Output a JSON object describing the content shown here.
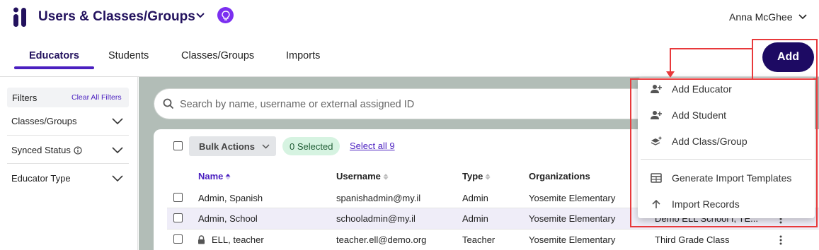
{
  "header": {
    "app_title": "Users & Classes/Groups",
    "user_name": "Anna McGhee"
  },
  "tabs": [
    {
      "label": "Educators",
      "active": true
    },
    {
      "label": "Students",
      "active": false
    },
    {
      "label": "Classes/Groups",
      "active": false
    },
    {
      "label": "Imports",
      "active": false
    }
  ],
  "add_button": {
    "label": "Add"
  },
  "sidebar": {
    "filters_label": "Filters",
    "clear_label": "Clear All Filters",
    "filters": [
      {
        "label": "Classes/Groups",
        "info_icon": false
      },
      {
        "label": "Synced Status",
        "info_icon": true
      },
      {
        "label": "Educator Type",
        "info_icon": false
      }
    ]
  },
  "search": {
    "placeholder": "Search by name, username or external assigned ID"
  },
  "toolbar": {
    "bulk_actions": "Bulk Actions",
    "selected": "0 Selected",
    "select_all": "Select all 9"
  },
  "table": {
    "columns": [
      "Name",
      "Username",
      "Type",
      "Organizations"
    ],
    "rows": [
      {
        "name": "Admin, Spanish",
        "username": "spanishadmin@my.il",
        "type": "Admin",
        "organization": "Yosemite Elementary",
        "class": "",
        "locked": false,
        "highlighted": false
      },
      {
        "name": "Admin, School",
        "username": "schooladmin@my.il",
        "type": "Admin",
        "organization": "Yosemite Elementary",
        "class": "Demo ELL School I, TE...",
        "locked": false,
        "highlighted": true
      },
      {
        "name": "ELL, teacher",
        "username": "teacher.ell@demo.org",
        "type": "Teacher",
        "organization": "Yosemite Elementary",
        "class": "Third Grade Class",
        "locked": true,
        "highlighted": false
      }
    ]
  },
  "add_menu": {
    "items": [
      {
        "label": "Add Educator",
        "icon": "add-person-icon"
      },
      {
        "label": "Add Student",
        "icon": "add-person-icon"
      },
      {
        "label": "Add Class/Group",
        "icon": "add-layers-icon"
      },
      {
        "label": "Generate Import Templates",
        "icon": "table-icon"
      },
      {
        "label": "Import Records",
        "icon": "arrow-up-icon"
      }
    ]
  },
  "colors": {
    "brand": "#23125e",
    "accent": "#4a1fc0",
    "add_button": "#1d0a63",
    "bulb": "#7b2ff0",
    "annotation": "#e8393b",
    "selected_pill": "#d6f3e1"
  }
}
